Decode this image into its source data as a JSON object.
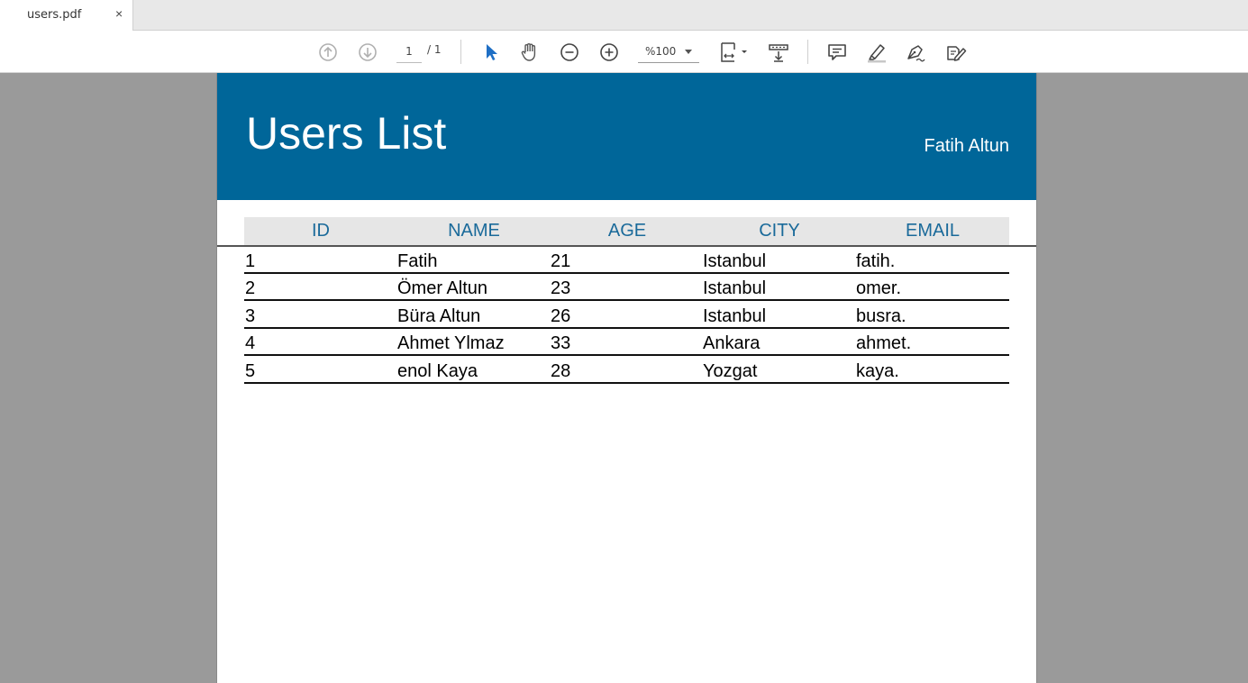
{
  "tab": {
    "title": "users.pdf",
    "close": "×"
  },
  "toolbar": {
    "page_current": "1",
    "page_total": "/ 1",
    "zoom": "%100"
  },
  "document": {
    "title": "Users List",
    "author": "Fatih Altun",
    "colors": {
      "banner": "#006699",
      "header_text": "#1a6a9a"
    },
    "table": {
      "headers": [
        "ID",
        "NAME",
        "AGE",
        "CITY",
        "EMAIL"
      ],
      "rows": [
        [
          "1",
          "Fatih",
          "21",
          "Istanbul",
          "fatih."
        ],
        [
          "2",
          "Ömer Altun",
          "23",
          "Istanbul",
          "omer."
        ],
        [
          "3",
          "Büra Altun",
          "26",
          "Istanbul",
          "busra."
        ],
        [
          "4",
          "Ahmet Ylmaz",
          "33",
          "Ankara",
          "ahmet."
        ],
        [
          "5",
          "enol Kaya",
          "28",
          "Yozgat",
          "kaya."
        ]
      ]
    }
  }
}
